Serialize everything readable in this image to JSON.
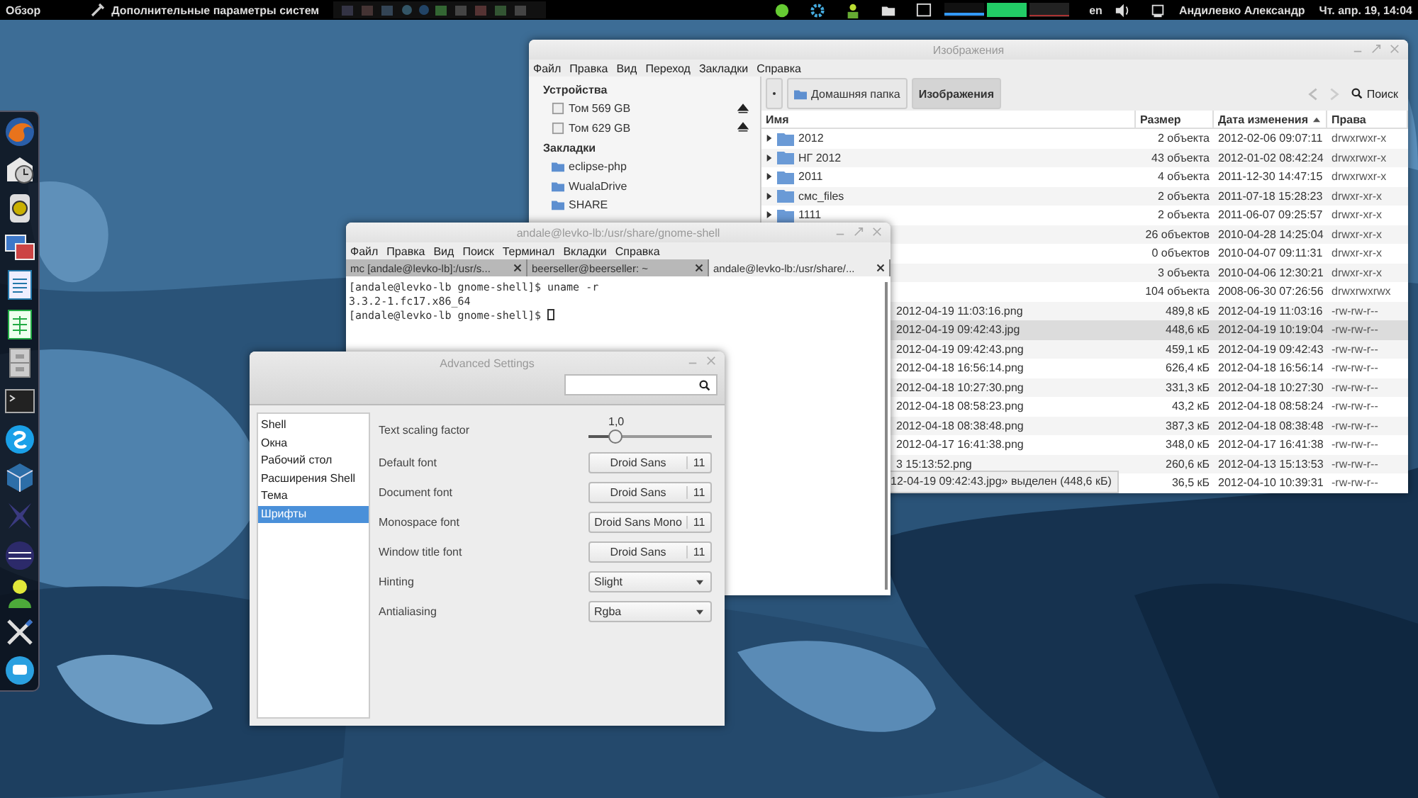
{
  "top_bar": {
    "activities": "Обзор",
    "app_title": "Дополнительные параметры систем",
    "keyboard_layout": "en",
    "user_name": "Андилевко Александр",
    "clock": "Чт. апр. 19, 14:04"
  },
  "file_manager": {
    "title": "Изображения",
    "menu": [
      "Файл",
      "Правка",
      "Вид",
      "Переход",
      "Закладки",
      "Справка"
    ],
    "sidebar": [
      {
        "heading": "Устройства",
        "items": [
          {
            "label": "Том 569 GB",
            "kind": "drive"
          },
          {
            "label": "Том 629 GB",
            "kind": "drive"
          }
        ]
      },
      {
        "heading": "Закладки",
        "items": [
          {
            "label": "eclipse-php",
            "kind": "folder"
          },
          {
            "label": "WualaDrive",
            "kind": "folder"
          },
          {
            "label": "SHARE",
            "kind": "folder"
          }
        ]
      }
    ],
    "path": [
      {
        "label": "Домашняя папка",
        "selected": false
      },
      {
        "label": "Изображения",
        "selected": true
      }
    ],
    "search": "Поиск",
    "columns": [
      {
        "label": "Имя",
        "sorted": false
      },
      {
        "label": "Размер",
        "sorted": false
      },
      {
        "label": "Дата изменения",
        "sorted": true
      },
      {
        "label": "Права",
        "sorted": false
      }
    ],
    "rows": [
      {
        "kind": "folder",
        "name": "2012",
        "size": "2 объекта",
        "modified": "2012-02-06 09:07:11",
        "permissions": "drwxrwxr-x",
        "selected": false
      },
      {
        "kind": "folder",
        "name": "НГ 2012",
        "size": "43 объекта",
        "modified": "2012-01-02 08:42:24",
        "permissions": "drwxrwxr-x",
        "selected": false
      },
      {
        "kind": "folder",
        "name": "2011",
        "size": "4 объекта",
        "modified": "2011-12-30 14:47:15",
        "permissions": "drwxrwxr-x",
        "selected": false
      },
      {
        "kind": "folder",
        "name": "смс_files",
        "size": "2 объекта",
        "modified": "2011-07-18 15:28:23",
        "permissions": "drwxr-xr-x",
        "selected": false
      },
      {
        "kind": "folder",
        "name": "1111",
        "size": "2 объекта",
        "modified": "2011-06-07 09:25:57",
        "permissions": "drwxr-xr-x",
        "selected": false
      },
      {
        "kind": "folder",
        "size": "26 объектов",
        "modified": "2010-04-28 14:25:04",
        "permissions": "drwxr-xr-x",
        "selected": false
      },
      {
        "kind": "folder",
        "size": "0 объектов",
        "modified": "2010-04-07 09:11:31",
        "permissions": "drwxr-xr-x",
        "selected": false
      },
      {
        "kind": "folder",
        "size": "3 объекта",
        "modified": "2010-04-06 12:30:21",
        "permissions": "drwxr-xr-x",
        "selected": false
      },
      {
        "kind": "folder",
        "size": "104 объекта",
        "modified": "2008-06-30 07:26:56",
        "permissions": "drwxrwxrwx",
        "selected": false
      },
      {
        "kind": "file",
        "name": "2012-04-19 11:03:16.png",
        "size": "489,8 кБ",
        "modified": "2012-04-19 11:03:16",
        "permissions": "-rw-rw-r--",
        "selected": false
      },
      {
        "kind": "file",
        "name": "2012-04-19 09:42:43.jpg",
        "size": "448,6 кБ",
        "modified": "2012-04-19 10:19:04",
        "permissions": "-rw-rw-r--",
        "selected": true
      },
      {
        "kind": "file",
        "name": "2012-04-19 09:42:43.png",
        "size": "459,1 кБ",
        "modified": "2012-04-19 09:42:43",
        "permissions": "-rw-rw-r--",
        "selected": false
      },
      {
        "kind": "file",
        "name": "2012-04-18 16:56:14.png",
        "size": "626,4 кБ",
        "modified": "2012-04-18 16:56:14",
        "permissions": "-rw-rw-r--",
        "selected": false
      },
      {
        "kind": "file",
        "name": "2012-04-18 10:27:30.png",
        "size": "331,3 кБ",
        "modified": "2012-04-18 10:27:30",
        "permissions": "-rw-rw-r--",
        "selected": false
      },
      {
        "kind": "file",
        "name": "2012-04-18 08:58:23.png",
        "size": "43,2 кБ",
        "modified": "2012-04-18 08:58:24",
        "permissions": "-rw-rw-r--",
        "selected": false
      },
      {
        "kind": "file",
        "name": "2012-04-18 08:38:48.png",
        "size": "387,3 кБ",
        "modified": "2012-04-18 08:38:48",
        "permissions": "-rw-rw-r--",
        "selected": false
      },
      {
        "kind": "file",
        "name": "2012-04-17 16:41:38.png",
        "size": "348,0 кБ",
        "modified": "2012-04-17 16:41:38",
        "permissions": "-rw-rw-r--",
        "selected": false
      },
      {
        "kind": "file",
        "name": "3 15:13:52.png",
        "size": "260,6 кБ",
        "modified": "2012-04-13 15:13:53",
        "permissions": "-rw-rw-r--",
        "selected": false
      },
      {
        "kind": "file",
        "size": "36,5 кБ",
        "modified": "2012-04-10 10:39:31",
        "permissions": "-rw-rw-r--",
        "selected": false
      }
    ],
    "status": "12-04-19 09:42:43.jpg» выделен (448,6 кБ)"
  },
  "terminal": {
    "title": "andale@levko-lb:/usr/share/gnome-shell",
    "menu": [
      "Файл",
      "Правка",
      "Вид",
      "Поиск",
      "Терминал",
      "Вкладки",
      "Справка"
    ],
    "tabs": [
      {
        "label": "mc [andale@levko-lb]:/usr/s...",
        "selected": false
      },
      {
        "label": "beerseller@beerseller: ~",
        "selected": false
      },
      {
        "label": "andale@levko-lb:/usr/share/...",
        "selected": true
      }
    ],
    "lines": [
      "[andale@levko-lb gnome-shell]$ uname -r",
      "3.3.2-1.fc17.x86_64",
      "[andale@levko-lb gnome-shell]$ "
    ]
  },
  "advanced_settings": {
    "title": "Advanced Settings",
    "sections": [
      {
        "label": "Shell",
        "selected": false
      },
      {
        "label": "Окна",
        "selected": false
      },
      {
        "label": "Рабочий стол",
        "selected": false
      },
      {
        "label": "Расширения Shell",
        "selected": false
      },
      {
        "label": "Тема",
        "selected": false
      },
      {
        "label": "Шрифты",
        "selected": true
      }
    ],
    "settings": [
      {
        "kind": "slider",
        "label": "Text scaling factor",
        "reading": "1,0",
        "level": 0.22
      },
      {
        "kind": "font",
        "label": "Default font",
        "font": "Droid Sans",
        "size": "11"
      },
      {
        "kind": "font",
        "label": "Document font",
        "font": "Droid Sans",
        "size": "11"
      },
      {
        "kind": "font",
        "label": "Monospace font",
        "font": "Droid Sans Mono",
        "size": "11"
      },
      {
        "kind": "font",
        "label": "Window title font",
        "font": "Droid Sans",
        "size": "11"
      },
      {
        "kind": "combo",
        "label": "Hinting",
        "value": "Slight"
      },
      {
        "kind": "combo",
        "label": "Antialiasing",
        "value": "Rgba"
      }
    ]
  }
}
